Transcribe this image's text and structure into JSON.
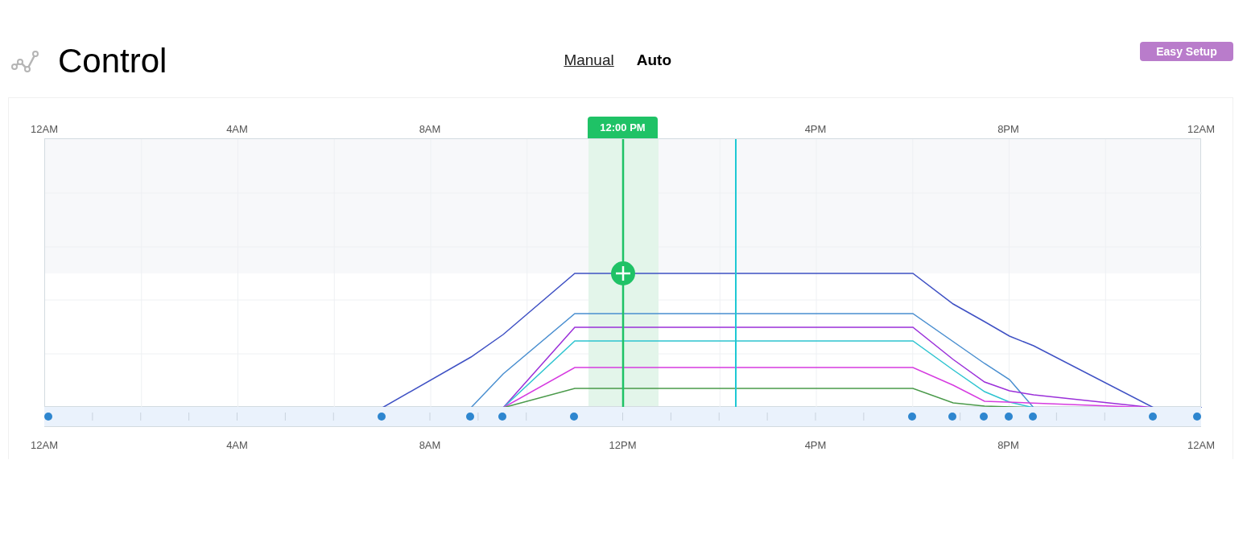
{
  "header": {
    "title": "Control"
  },
  "mode_tabs": [
    {
      "label": "Manual",
      "selected": false
    },
    {
      "label": "Auto",
      "selected": true
    }
  ],
  "easy_setup_button": "Easy Setup",
  "chart": {
    "current_time_badge": "12:00 PM",
    "top_axis_labels": [
      "12AM",
      "4AM",
      "8AM",
      "4PM",
      "8PM",
      "12AM"
    ],
    "bottom_axis_labels": [
      "12AM",
      "4AM",
      "8AM",
      "12PM",
      "4PM",
      "8PM",
      "12AM"
    ]
  }
}
